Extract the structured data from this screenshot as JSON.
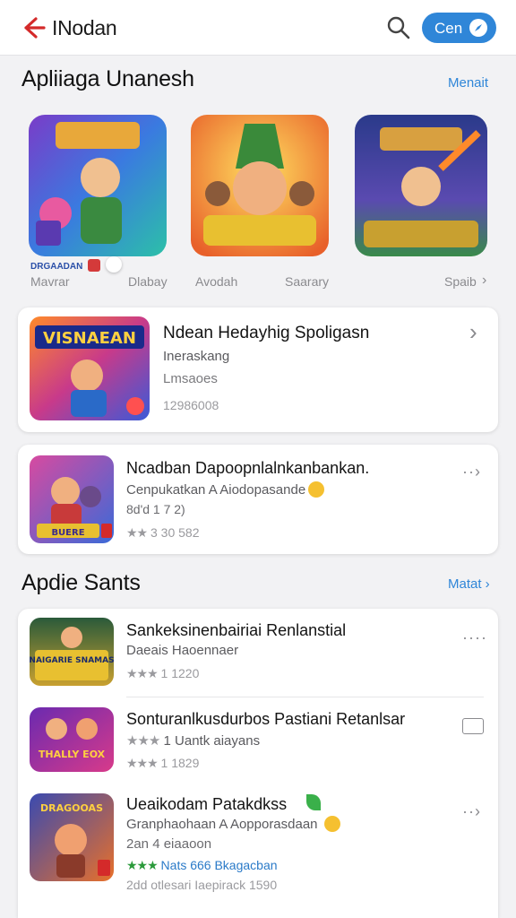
{
  "header": {
    "title": "INodan",
    "button_label": "Cen"
  },
  "featured": {
    "title": "Apliiaga Unanesh",
    "see_all": "Menait",
    "items": [
      {
        "label": "Mavrar",
        "badge": "DRGAADAN"
      },
      {
        "label": "Dlabay"
      },
      {
        "label": "Avodah"
      },
      {
        "label": "Saarary"
      },
      {
        "label": "Spaib"
      }
    ]
  },
  "highlight": {
    "title": "Ndean Hedayhig Spoligasn",
    "subtitle": "Ineraskang",
    "line2": "Lmsaoes",
    "meta": "12986008",
    "icon_text": "VISNAEAN"
  },
  "promo": {
    "title": "Ncadban Dapoopnlalnkanbankan.",
    "subtitle": "Cenpukatkan A Aiodopasande",
    "meta1": "8d'd 1 7 2)",
    "stars": "★★",
    "rating": "3 30 582",
    "icon_text": "BUERE"
  },
  "section2": {
    "title": "Apdie Sants",
    "see_all": "Matat",
    "items": [
      {
        "title": "Sankeksinenbairiai Renlanstial",
        "subtitle": "Daeais Haoennaer",
        "stars": "★★★",
        "rating": "1 1220",
        "icon_text": "NAIGARIE SNAMAS"
      },
      {
        "title": "Sonturanlkusdurbos Pastiani Retanlsar",
        "subtitle_stars": "★★★",
        "subtitle": "1 Uantk aiayans",
        "stars": "★★★",
        "rating": "1 1829",
        "icon_text": "THALLY EOX"
      },
      {
        "title": "Ueaikodam Patakdkss",
        "subtitle": "Granphaohaan A Aopporasdaan",
        "line3": "2an 4 eiaaoon",
        "stars": "★★★",
        "green_text": "Nats 666 Bkagacban",
        "meta": "2dd otlesari Iaepirack 1590",
        "icon_text": "DRAGOOAS"
      }
    ]
  }
}
